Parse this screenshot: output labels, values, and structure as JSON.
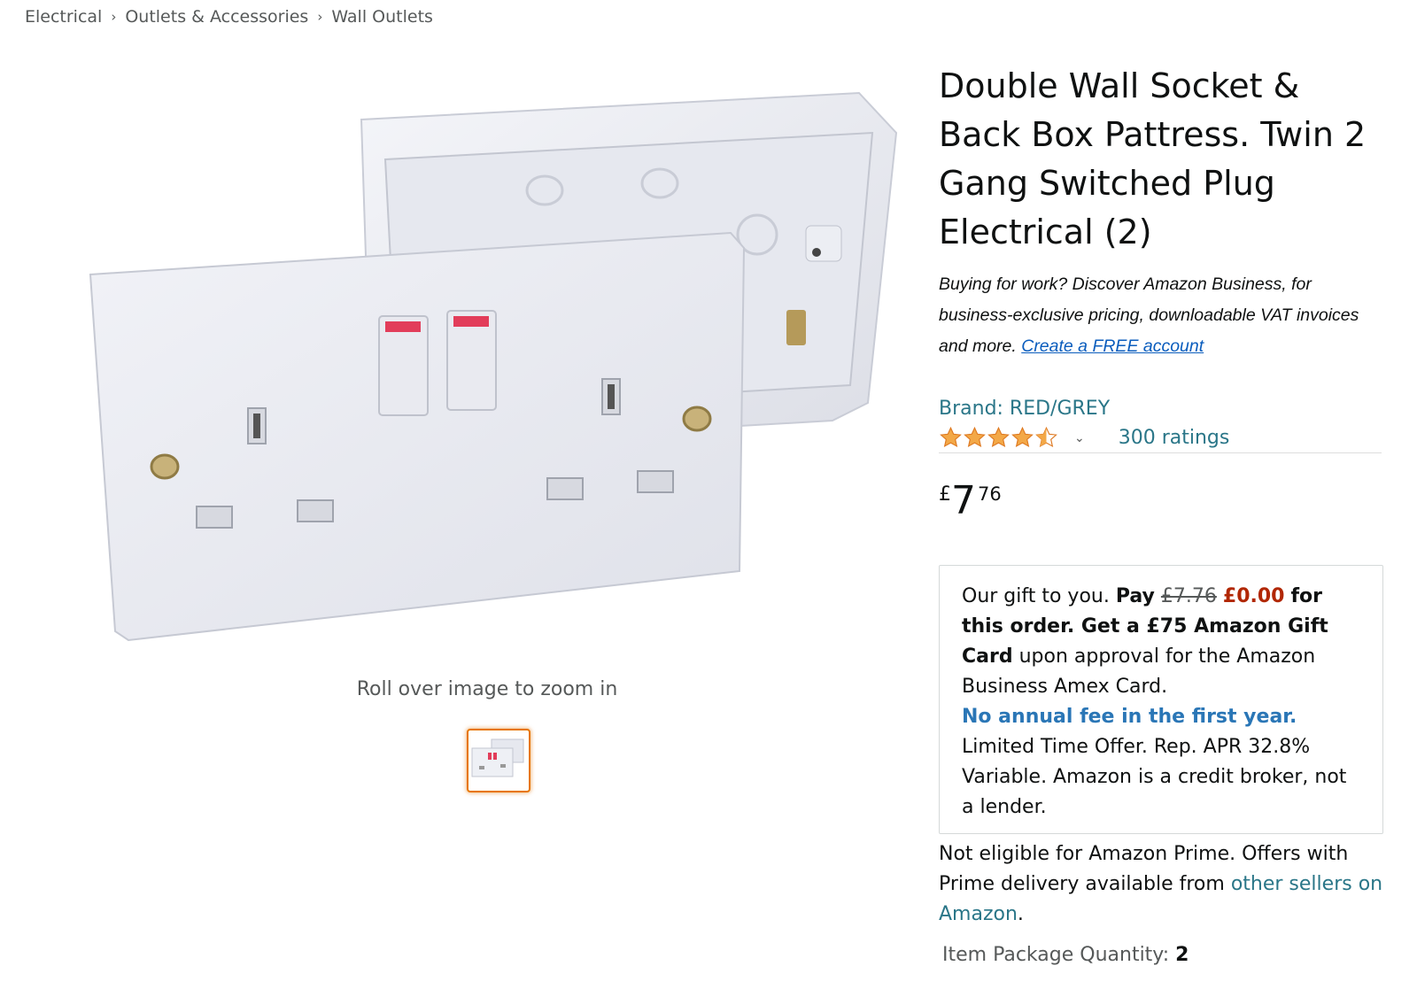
{
  "breadcrumb": {
    "items": [
      "Electrical",
      "Outlets & Accessories",
      "Wall Outlets"
    ]
  },
  "gallery": {
    "zoom_hint": "Roll over image to zoom in"
  },
  "product": {
    "title": "Double Wall Socket & Back Box Pattress. Twin 2 Gang Switched Plug Electrical (2)",
    "business_promo": {
      "text": "Buying for work? Discover Amazon Business, for business-exclusive pricing, downloadable VAT invoices and more.",
      "link": "Create a FREE account"
    },
    "brand": "Brand: RED/GREY",
    "rating": {
      "stars": 4.5,
      "count_label": "300 ratings"
    },
    "price": {
      "symbol": "£",
      "whole": "7",
      "fraction": "76"
    },
    "offer": {
      "intro": "Our gift to you.",
      "pay": "Pay",
      "old_price": "£7.76",
      "new_price": "£0.00",
      "bold_text": "for this order. Get a £75 Amazon Gift Card",
      "body": "upon approval for the Amazon Business Amex Card.",
      "highlight": "No annual fee in the first year.",
      "terms": "Limited Time Offer. Rep. APR 32.8% Variable. Amazon is a credit broker, not a lender."
    },
    "prime_note": {
      "text": "Not eligible for Amazon Prime. Offers with Prime delivery available from",
      "link": "other sellers on Amazon",
      "end": "."
    },
    "quantity": {
      "label": "Item Package Quantity:",
      "value": "2"
    }
  },
  "colors": {
    "link_teal": "#2a7688",
    "link_blue": "#0b5dbd",
    "price_red": "#b12704",
    "star_orange": "#f3a847",
    "thumb_border": "#e77600"
  }
}
